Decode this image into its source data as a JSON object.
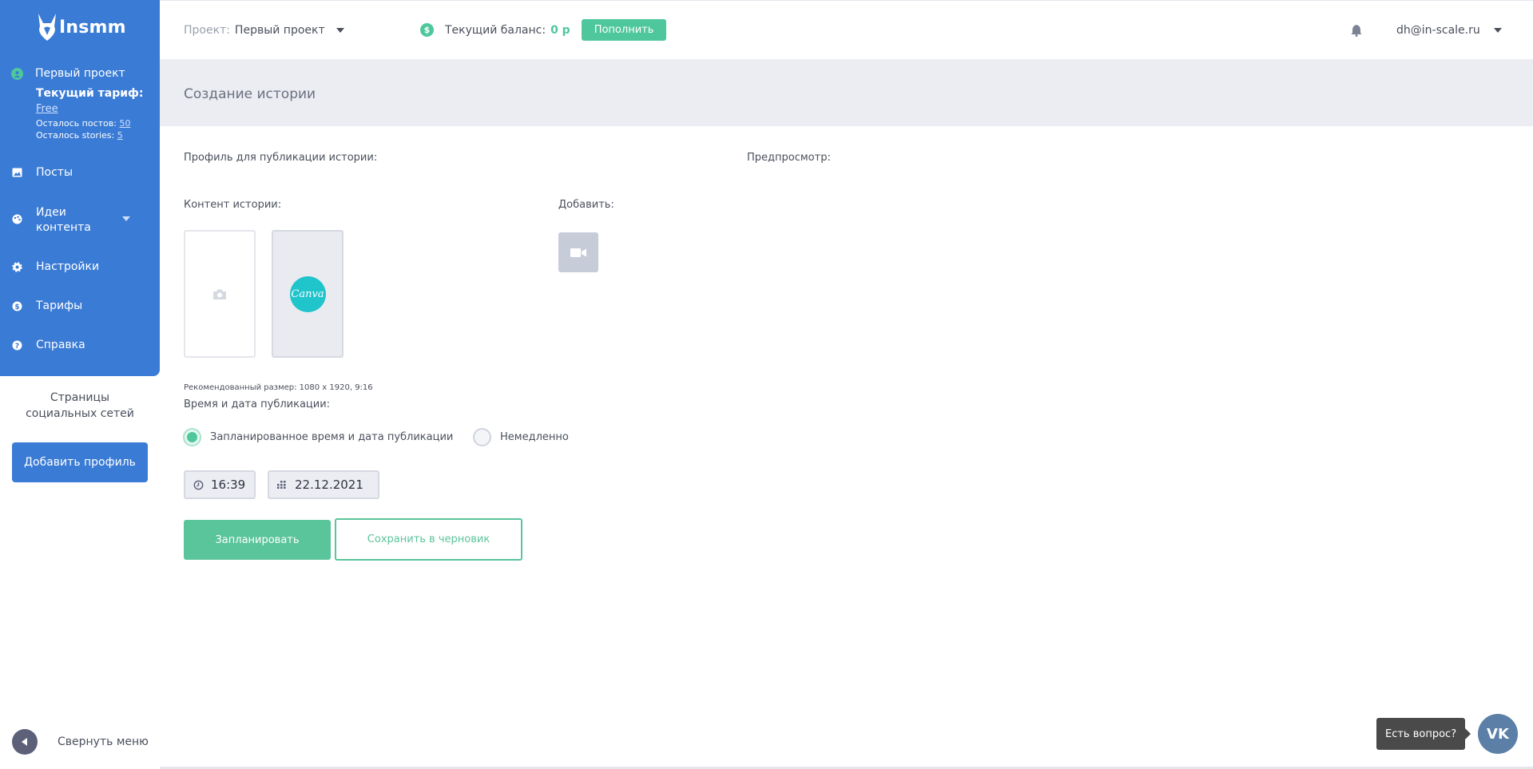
{
  "logo": {
    "text": "Insmm",
    "icon": "fox-logo-icon"
  },
  "sidebar": {
    "project_name": "Первый проект",
    "tariff_title": "Текущий тариф:",
    "tariff_name": "Free",
    "posts_left_label": "Осталось постов:",
    "posts_left_value": "50",
    "stories_left_label": "Осталось stories:",
    "stories_left_value": "5",
    "items": [
      {
        "label": "Посты",
        "icon": "image-icon"
      },
      {
        "label_line1": "Идеи",
        "label_line2": "контента",
        "icon": "palette-icon"
      },
      {
        "label": "Настройки",
        "icon": "gear-icon"
      },
      {
        "label": "Тарифы",
        "icon": "dollar-icon"
      },
      {
        "label": "Справка",
        "icon": "help-icon"
      }
    ],
    "social_title_line1": "Страницы",
    "social_title_line2": "социальных сетей",
    "add_profile": "Добавить профиль",
    "collapse": "Свернуть меню",
    "accent": "#3a7bd5"
  },
  "topbar": {
    "project_label": "Проект:",
    "project_value": "Первый проект",
    "balance_label": "Текущий баланс:",
    "balance_value": "0 р",
    "topup": "Пополнить",
    "user": "dh@in-scale.ru",
    "accent": "#4ec79c"
  },
  "page": {
    "title": "Создание истории",
    "profile_label": "Профиль для публикации истории:",
    "preview_label": "Предпросмотр:",
    "content_label": "Контент истории:",
    "add_label": "Добавить:",
    "canva": "Canva",
    "recommended": "Рекомендованный размер: 1080 х 1920, 9:16",
    "time_label": "Время и дата публикации:",
    "radio_scheduled": "Запланированное время и дата публикации",
    "radio_now": "Немедленно",
    "time": "16:39",
    "date": "22.12.2021",
    "btn_schedule": "Запланировать",
    "btn_draft": "Сохранить в черновик"
  },
  "help": {
    "text": "Есть вопрос?",
    "vk": "VK"
  }
}
